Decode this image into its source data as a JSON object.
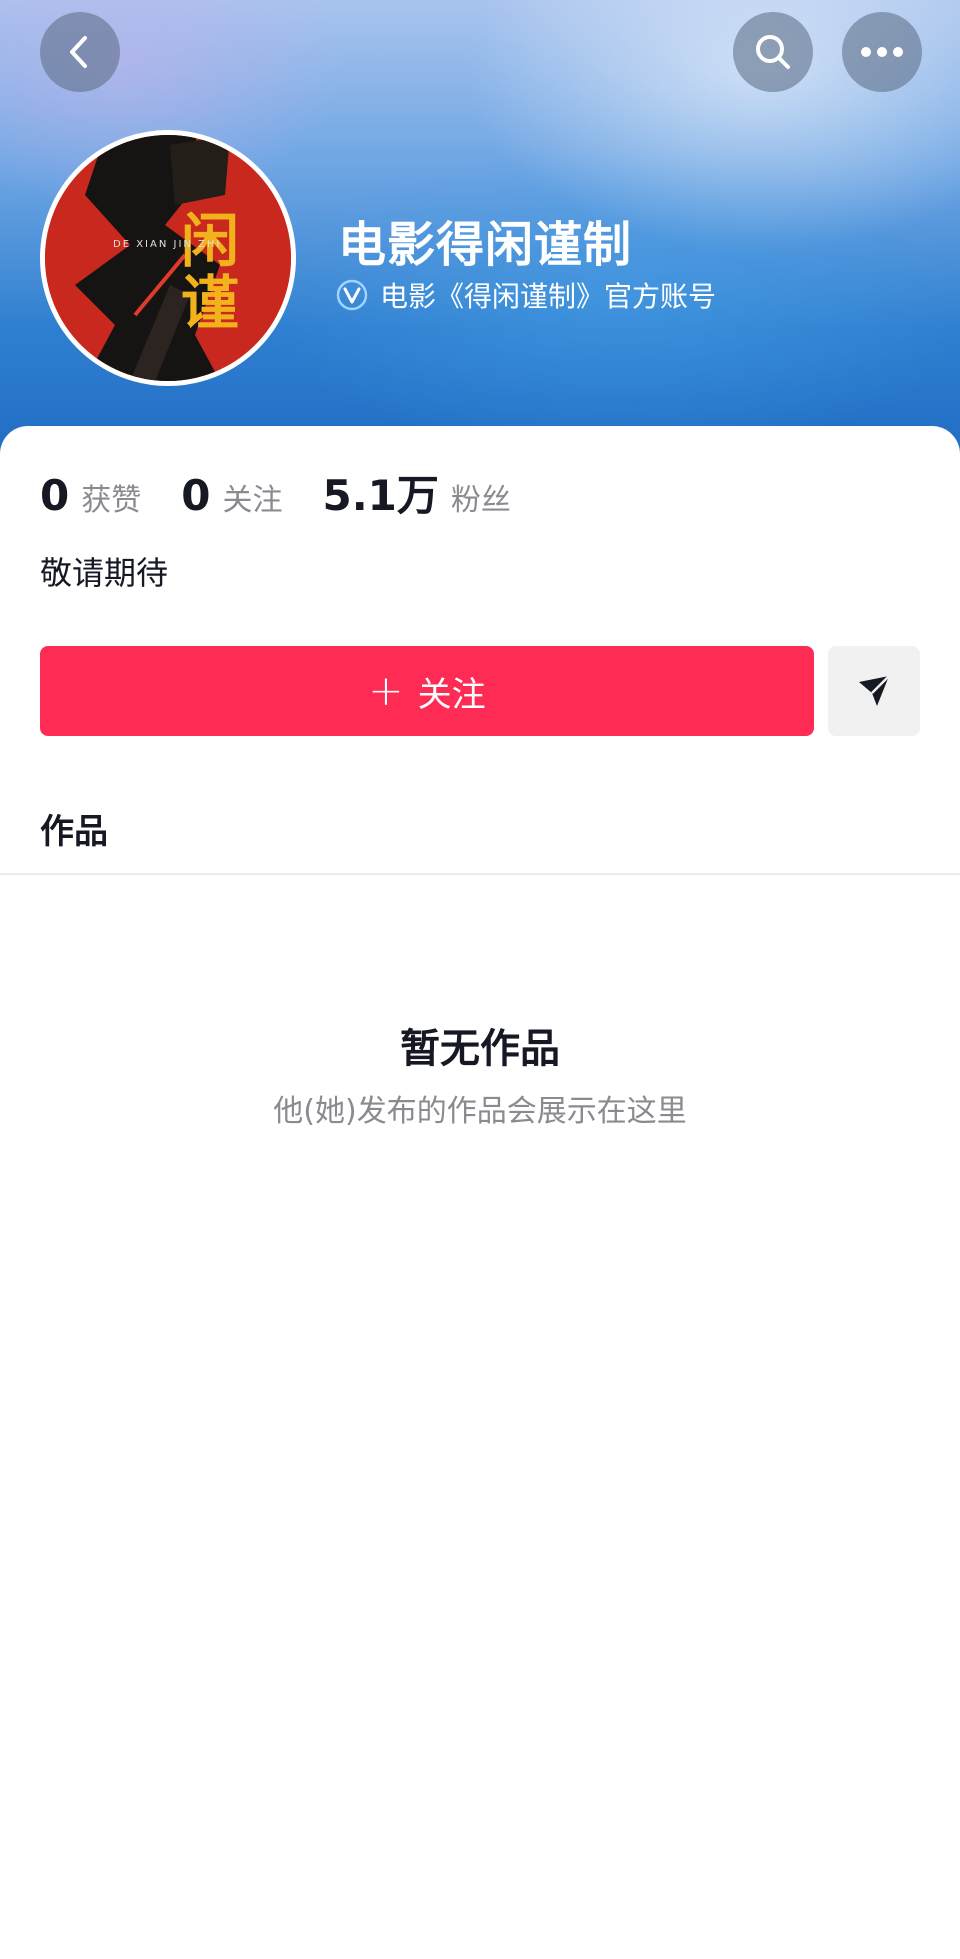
{
  "header": {
    "back_icon": "chevron-left-icon",
    "search_icon": "search-icon",
    "more_icon": "more-horizontal-icon"
  },
  "profile": {
    "name": "电影得闲谨制",
    "verified_icon": "verified-badge-icon",
    "verified_text": "电影《得闲谨制》官方账号",
    "avatar_text": "闲谨",
    "avatar_subtext": "DE XIAN JIN ZHI"
  },
  "stats": [
    {
      "value": "0",
      "label": "获赞"
    },
    {
      "value": "0",
      "label": "关注"
    },
    {
      "value": "5.1万",
      "label": "粉丝"
    }
  ],
  "bio": "敬请期待",
  "actions": {
    "follow_label": "关注",
    "follow_plus": "+",
    "follow_color": "#fe2c55",
    "message_icon": "send-icon"
  },
  "tabs": {
    "works_label": "作品"
  },
  "empty_state": {
    "title": "暂无作品",
    "subtitle": "他(她)发布的作品会展示在这里"
  }
}
